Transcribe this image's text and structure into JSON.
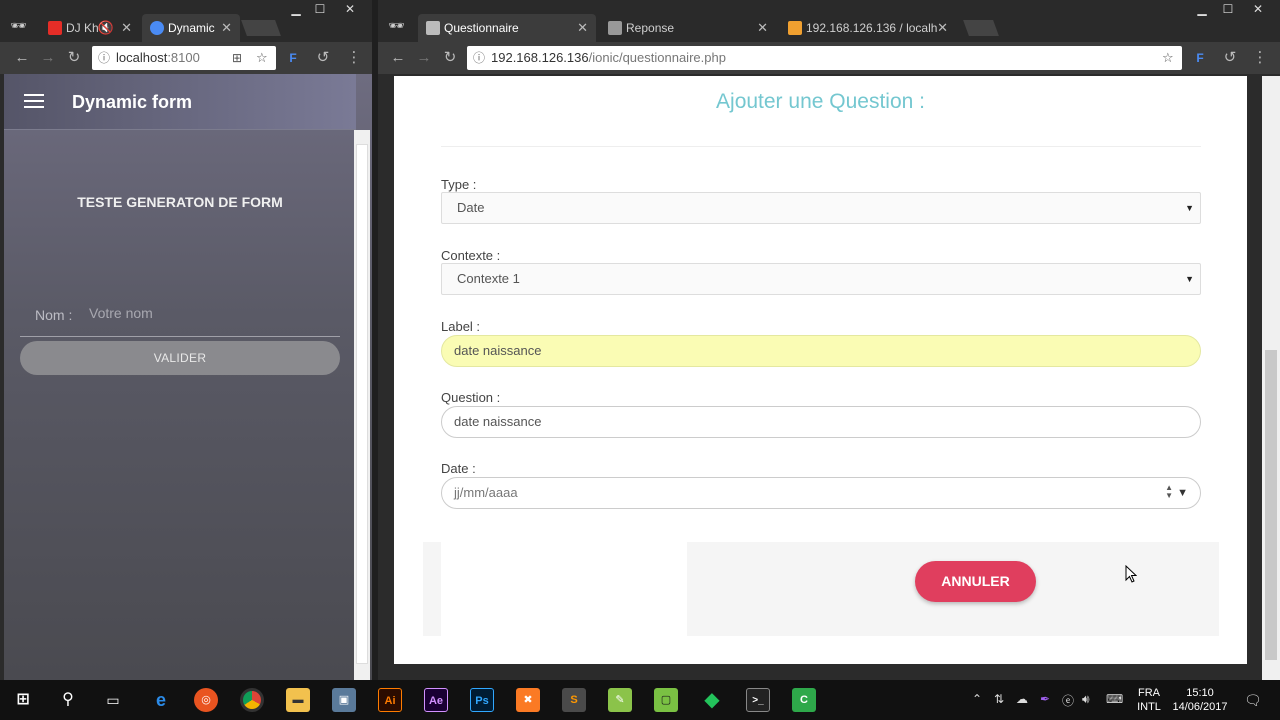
{
  "left_window": {
    "tabs": [
      {
        "label": "DJ Kh",
        "active": false
      },
      {
        "label": "Dynamic",
        "active": true
      }
    ],
    "url": "localhost",
    "url_port": ":8100",
    "app": {
      "title": "Dynamic form",
      "heading": "TESTE GENERATON DE FORM",
      "nom_label": "Nom :",
      "nom_placeholder": "Votre nom",
      "valider_label": "VALIDER"
    }
  },
  "right_window": {
    "tabs": [
      {
        "label": "Questionnaire",
        "active": true
      },
      {
        "label": "Reponse",
        "active": false
      },
      {
        "label": "192.168.126.136 / localh",
        "active": false
      }
    ],
    "url_host": "192.168.126.136",
    "url_path": "/ionic/questionnaire.php",
    "page": {
      "title": "Ajouter une Question :",
      "type_label": "Type :",
      "type_value": "Date",
      "contexte_label": "Contexte :",
      "contexte_value": "Contexte 1",
      "label_label": "Label :",
      "label_value": "date naissance",
      "question_label": "Question :",
      "question_value": "date naissance",
      "date_label": "Date :",
      "date_value": "jj/mm/aaaa",
      "annuler_label": "ANNULER"
    }
  },
  "taskbar": {
    "language": "FRA",
    "layout": "INTL",
    "time": "15:10",
    "date": "14/06/2017",
    "apps": [
      "windows",
      "search",
      "task-view",
      "edge",
      "ubuntu",
      "chrome",
      "file-explorer",
      "installer",
      "illustrator",
      "after-effects",
      "photoshop",
      "xampp",
      "sublime",
      "notepad",
      "camtasia",
      "git",
      "terminal",
      "codeigniter"
    ]
  },
  "colors": {
    "accent_teal": "#74c7d0",
    "annuler_red": "#e03e5e",
    "autofill_yellow": "#fafcb4"
  }
}
